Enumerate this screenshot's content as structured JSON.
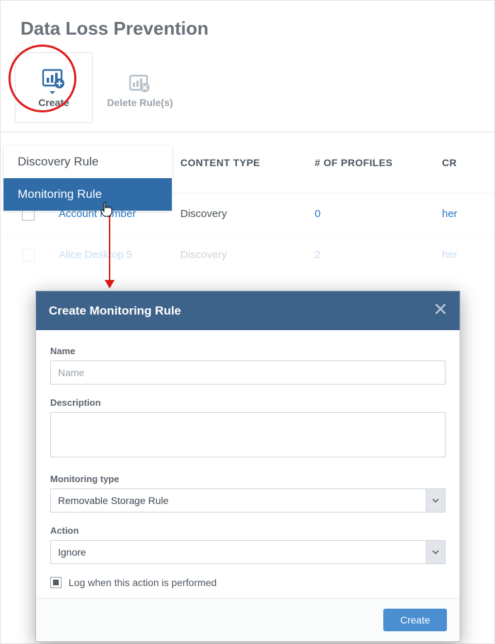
{
  "page_title": "Data Loss Prevention",
  "toolbar": {
    "create_label": "Create",
    "delete_label": "Delete Rule(s)"
  },
  "create_menu": {
    "items": [
      {
        "label": "Discovery Rule"
      },
      {
        "label": "Monitoring Rule"
      }
    ]
  },
  "table": {
    "headers": {
      "content_type": "CONTENT TYPE",
      "profiles": "# OF PROFILES",
      "last": "CR"
    },
    "rows": [
      {
        "name": "Account number",
        "type": "Discovery",
        "profiles": "0",
        "cr": "her"
      },
      {
        "name": "Alice Desktop 5",
        "type": "Discovery",
        "profiles": "2",
        "cr": "her"
      }
    ]
  },
  "modal": {
    "title": "Create Monitoring Rule",
    "name_label": "Name",
    "name_placeholder": "Name",
    "desc_label": "Description",
    "montype_label": "Monitoring type",
    "montype_value": "Removable Storage Rule",
    "action_label": "Action",
    "action_value": "Ignore",
    "log_label": "Log when this action is performed",
    "create_btn": "Create"
  },
  "icons": {
    "create": "create-report-icon",
    "delete": "delete-report-icon",
    "close": "close-icon",
    "chevron": "chevron-down-icon"
  },
  "colors": {
    "accent": "#3e638a",
    "link": "#2378c4",
    "highlight": "#e01b1b"
  }
}
